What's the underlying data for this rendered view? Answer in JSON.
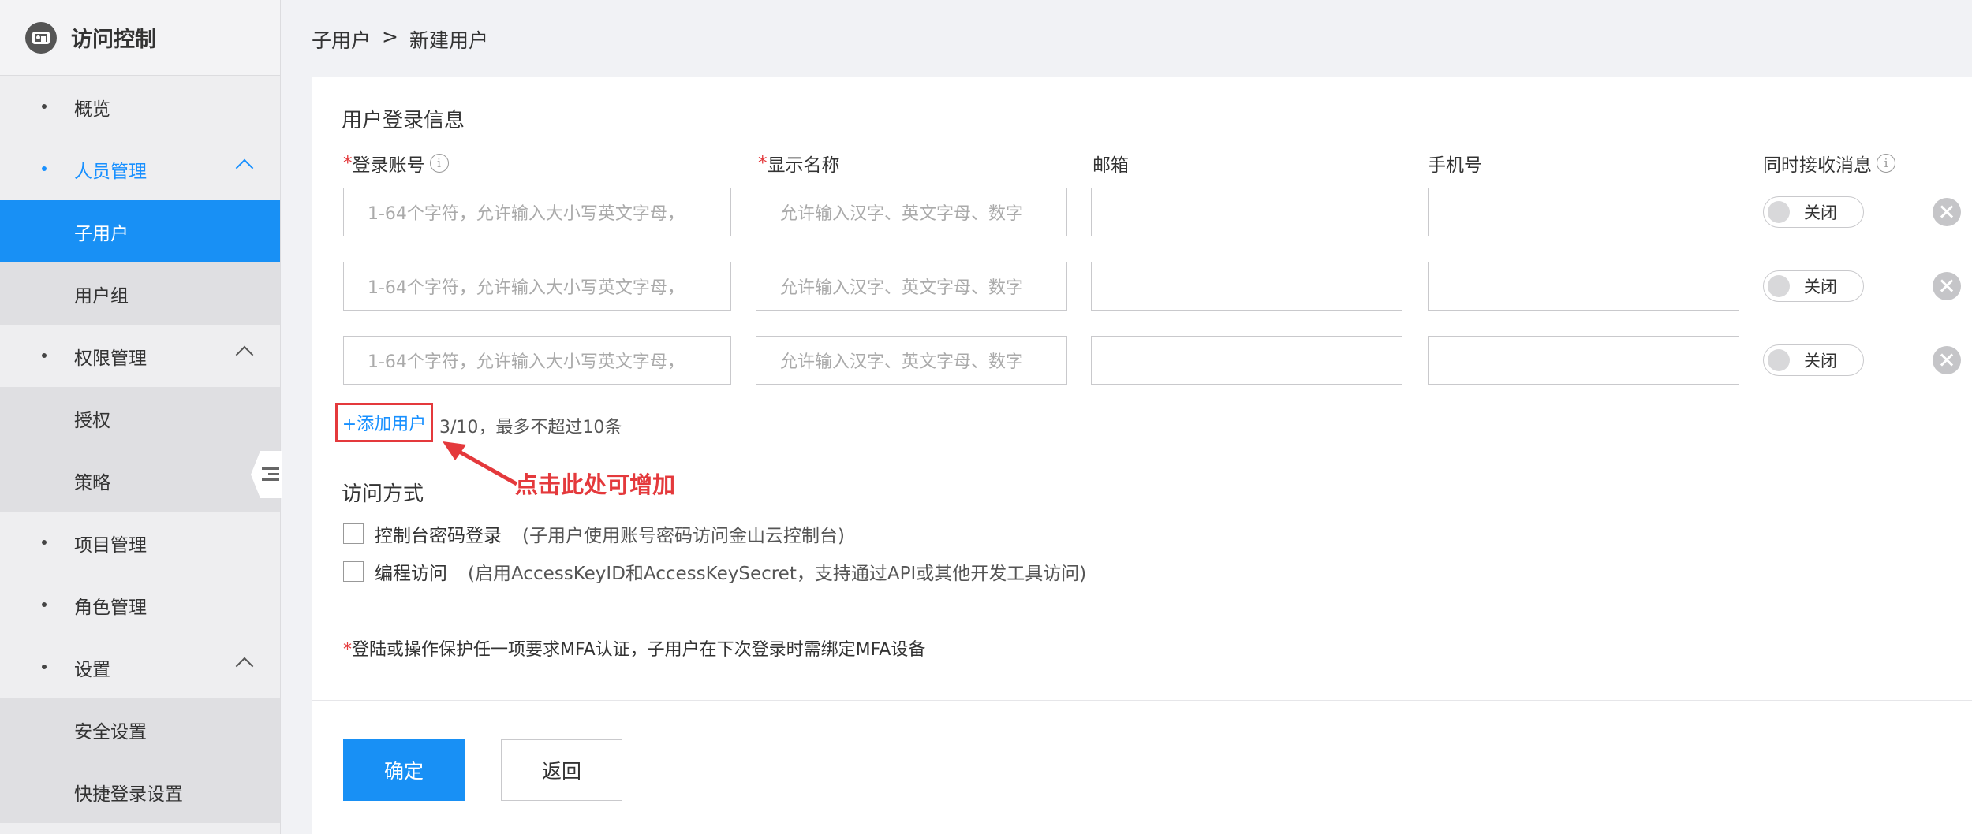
{
  "sidebar": {
    "title": "访问控制",
    "logo_icon": "access-control-icon",
    "items": [
      {
        "label": "概览"
      },
      {
        "label": "人员管理",
        "children": [
          {
            "label": "子用户"
          },
          {
            "label": "用户组"
          }
        ]
      },
      {
        "label": "权限管理",
        "children": [
          {
            "label": "授权"
          },
          {
            "label": "策略"
          }
        ]
      },
      {
        "label": "项目管理"
      },
      {
        "label": "角色管理"
      },
      {
        "label": "设置",
        "children": [
          {
            "label": "安全设置"
          },
          {
            "label": "快捷登录设置"
          }
        ]
      }
    ]
  },
  "breadcrumb": {
    "parent": "子用户",
    "separator": ">",
    "current": "新建用户"
  },
  "form": {
    "section_title": "用户登录信息",
    "columns": {
      "required_mark": "*",
      "login_account": "登录账号",
      "display_name": "显示名称",
      "email": "邮箱",
      "phone": "手机号",
      "receive_messages": "同时接收消息"
    },
    "placeholders": {
      "login_account": "1-64个字符，允许输入大小写英文字母，",
      "display_name": "允许输入汉字、英文字母、数字",
      "email": "",
      "phone": ""
    },
    "rows": [
      {
        "toggle_label": "关闭"
      },
      {
        "toggle_label": "关闭"
      },
      {
        "toggle_label": "关闭"
      }
    ],
    "add_user_label": "+添加用户",
    "add_user_hint": "3/10，最多不超过10条",
    "annotation": "点击此处可增加",
    "access_title": "访问方式",
    "access_options": [
      {
        "label": "控制台密码登录",
        "hint": "(子用户使用账号密码访问金山云控制台)"
      },
      {
        "label": "编程访问",
        "hint": "(启用AccessKeyID和AccessKeySecret，支持通过API或其他开发工具访问)"
      }
    ],
    "mfa_note": "登陆或操作保护任一项要求MFA认证，子用户在下次登录时需绑定MFA设备",
    "confirm_label": "确定",
    "back_label": "返回"
  },
  "colors": {
    "primary": "#1890f5",
    "required": "#e4393c",
    "annotation": "#e4393c"
  }
}
